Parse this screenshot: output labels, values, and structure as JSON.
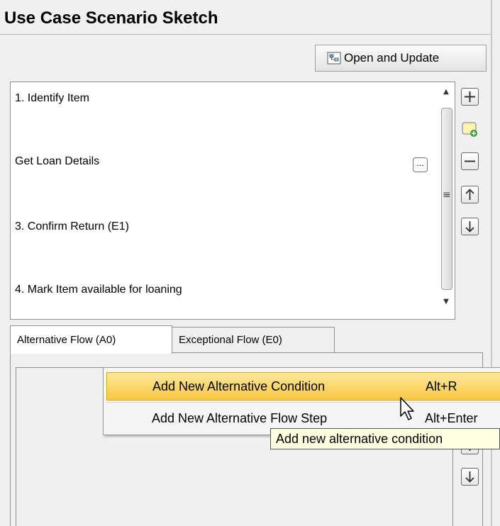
{
  "panel": {
    "title": "Use Case Scenario Sketch"
  },
  "toolbar": {
    "open_update_label": "Open and Update",
    "open_update_icon": "diagram-open-icon"
  },
  "steps": {
    "items": [
      {
        "label": "1. Identify Item"
      },
      {
        "label": "Get Loan Details"
      },
      {
        "label": "3. Confirm Return (E1)"
      },
      {
        "label": "4. Mark Item available for loaning"
      }
    ],
    "ellipsis_label": "..."
  },
  "side_tools": [
    "add-icon",
    "add-alternative-icon",
    "remove-icon",
    "move-up-icon",
    "move-down-icon"
  ],
  "tabs": [
    {
      "label": "Alternative Flow (A0)",
      "active": true
    },
    {
      "label": "Exceptional Flow (E0)",
      "active": false
    }
  ],
  "context_menu": {
    "items": [
      {
        "label": "Add New Alternative Condition",
        "shortcut": "Alt+R",
        "highlighted": true
      },
      {
        "label": "Add New Alternative Flow Step",
        "shortcut": "Alt+Enter",
        "highlighted": false
      }
    ]
  },
  "tooltip": {
    "text": "Add new alternative condition"
  },
  "colors": {
    "menu_highlight": "#f8c842",
    "tooltip_bg": "#ffffe1"
  }
}
